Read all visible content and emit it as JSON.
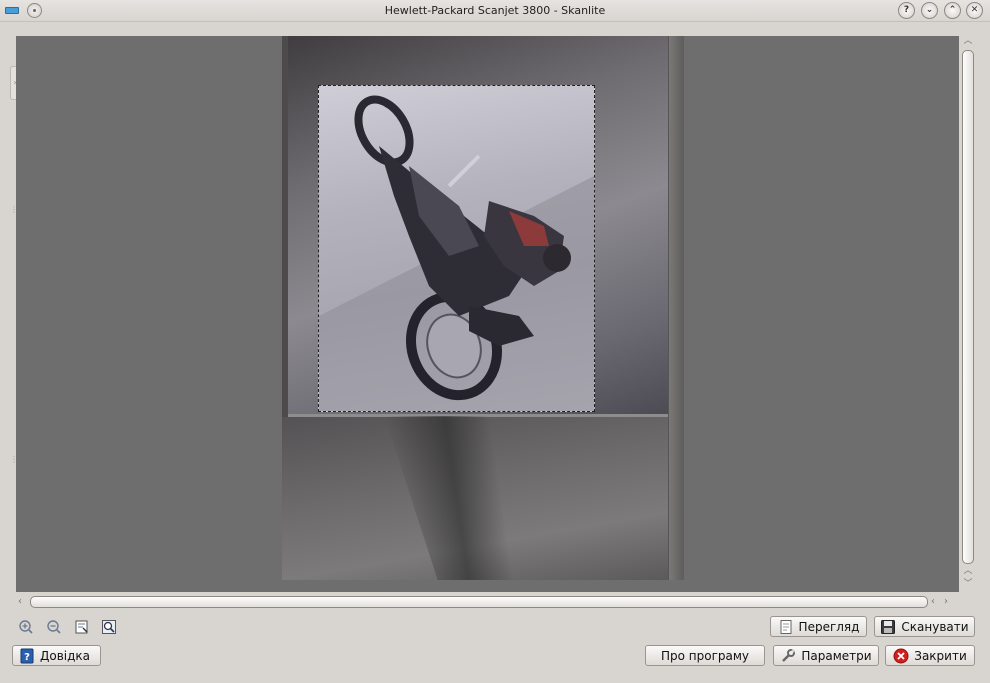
{
  "window": {
    "title": "Hewlett-Packard Scanjet 3800 - Skanlite"
  },
  "titlebar_buttons": {
    "help": "?",
    "minimize": "⌄",
    "maximize": "⌃",
    "close": "✕"
  },
  "toolbar_icons": [
    "zoom-in-icon",
    "zoom-out-icon",
    "zoom-to-selection-icon",
    "zoom-fit-icon"
  ],
  "buttons": {
    "preview": "Перегляд",
    "scan": "Сканувати",
    "help": "Довідка",
    "about": "Про програму",
    "settings": "Параметри",
    "close": "Закрити"
  },
  "colors": {
    "preview_bg": "#6e6e6e",
    "window_bg": "#d8d4d0",
    "close_icon": "#d02020",
    "help_icon": "#2a5fb0"
  }
}
